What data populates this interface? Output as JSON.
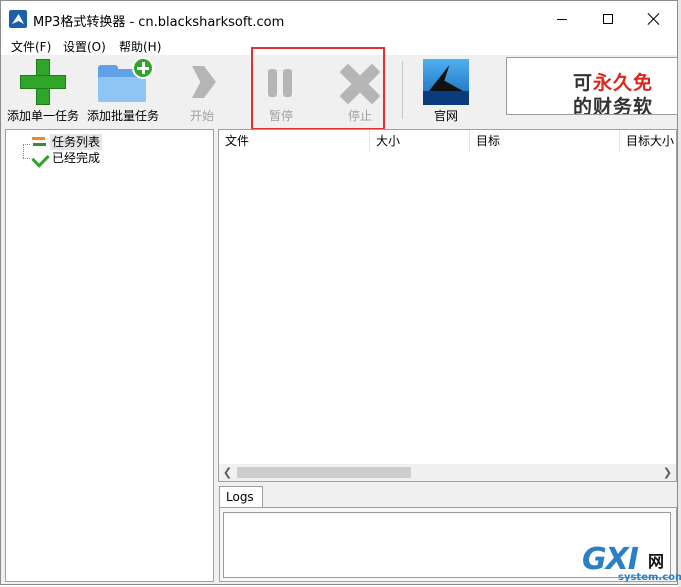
{
  "window": {
    "title": "MP3格式转换器 - cn.blacksharksoft.com"
  },
  "menu": {
    "items": [
      {
        "label": "文件(F)"
      },
      {
        "label": "设置(O)"
      },
      {
        "label": "帮助(H)"
      }
    ]
  },
  "toolbar": {
    "add_single": "添加单一任务",
    "add_batch": "添加批量任务",
    "start": "开始",
    "pause": "暂停",
    "stop": "停止",
    "website": "官网"
  },
  "ad": {
    "line1_prefix": "可",
    "line1_highlight": "永久免",
    "line2": "的财务软"
  },
  "tree": {
    "items": [
      {
        "label": "任务列表",
        "icon": "swap-arrows-icon",
        "selected": true
      },
      {
        "label": "已经完成",
        "icon": "check-icon",
        "selected": false
      }
    ]
  },
  "table": {
    "columns": [
      "文件",
      "大小",
      "目标",
      "目标大小"
    ]
  },
  "logs": {
    "tab_label": "Logs"
  },
  "watermark": {
    "main": "GXI",
    "cn": "网",
    "sub": "system.com"
  },
  "colors": {
    "highlight_border": "#e03030",
    "ad_red": "#e0261c",
    "watermark_blue": "#2b7fc4"
  }
}
